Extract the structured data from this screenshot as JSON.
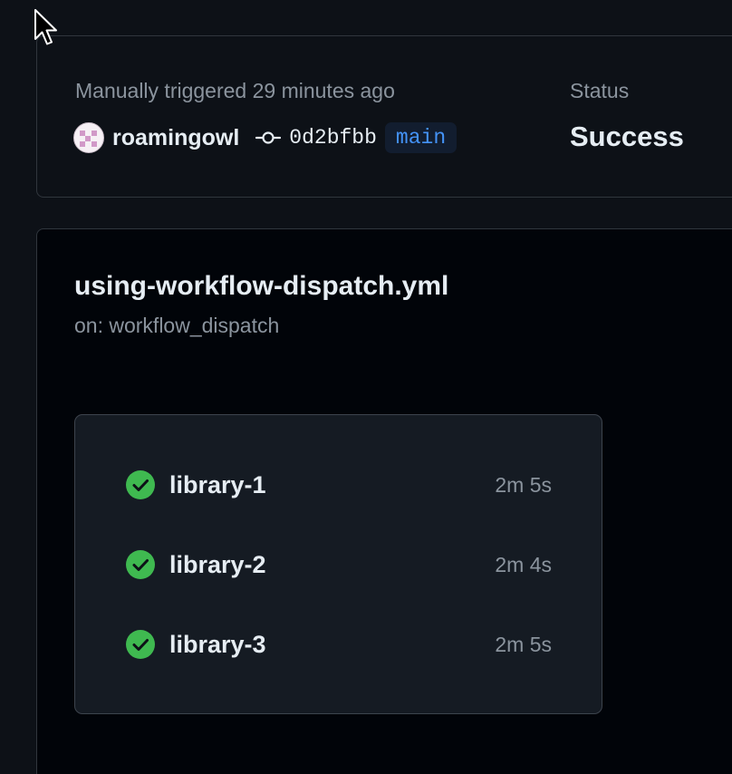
{
  "run": {
    "trigger_text": "Manually triggered 29 minutes ago",
    "actor": "roamingowl",
    "commit_sha": "0d2bfbb",
    "branch": "main",
    "status_label": "Status",
    "status_value": "Success"
  },
  "workflow": {
    "file_name": "using-workflow-dispatch.yml",
    "trigger": "on: workflow_dispatch"
  },
  "jobs": [
    {
      "name": "library-1",
      "duration": "2m 5s",
      "status": "success"
    },
    {
      "name": "library-2",
      "duration": "2m 4s",
      "status": "success"
    },
    {
      "name": "library-3",
      "duration": "2m 5s",
      "status": "success"
    }
  ],
  "colors": {
    "success": "#3fb950",
    "branch_text": "#4493f8",
    "branch_bg": "#121d2f",
    "muted_text": "#8b949e"
  },
  "icons": {
    "commit": "git-commit-icon",
    "success": "check-circle-fill-icon",
    "cursor": "mouse-pointer-icon"
  }
}
